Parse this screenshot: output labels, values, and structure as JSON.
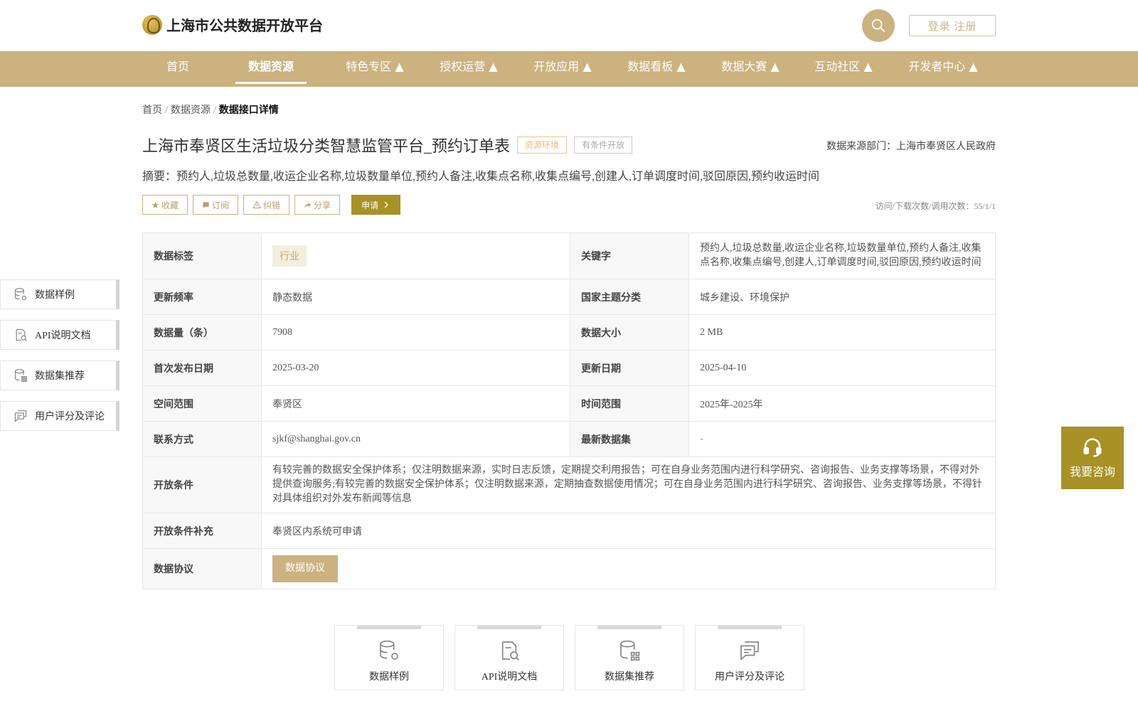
{
  "header": {
    "site_title": "上海市公共数据开放平台",
    "login_label": "登录 注册"
  },
  "nav": [
    {
      "label": "首页"
    },
    {
      "label": "数据资源"
    },
    {
      "label": "特色专区 ▲"
    },
    {
      "label": "授权运营 ▲"
    },
    {
      "label": "开放应用 ▲"
    },
    {
      "label": "数据看板 ▲"
    },
    {
      "label": "数据大赛 ▲"
    },
    {
      "label": "互动社区 ▲"
    },
    {
      "label": "开发者中心 ▲"
    }
  ],
  "breadcrumb": [
    "首页",
    "数据资源",
    "数据接口详情"
  ],
  "detail": {
    "title": "上海市奉贤区生活垃圾分类智慧监管平台_预约订单表",
    "tag_env": "资源环境",
    "tag_open": "有条件开放",
    "source_label": "数据来源部门：上海市奉贤区人民政府",
    "summary": "摘要：预约人,垃圾总数量,收运企业名称,垃圾数量单位,预约人备注,收集点名称,收集点编号,创建人,订单调度时间,驳回原因,预约收运时间",
    "visits": "访问/下载次数/调用次数：55/1/1"
  },
  "actions": {
    "favorite": "收藏",
    "subscribe": "订阅",
    "correct": "纠错",
    "share": "分享",
    "apply": "申请"
  },
  "table": {
    "tag_key": "数据标签",
    "tag_val": "行业",
    "keyword_key": "关键字",
    "keyword_val": "预约人,垃圾总数量,收运企业名称,垃圾数量单位,预约人备注,收集点名称,收集点编号,创建人,订单调度时间,驳回原因,预约收运时间",
    "freq_key": "更新频率",
    "freq_val": "静态数据",
    "theme_key": "国家主题分类",
    "theme_val": "城乡建设、环境保护",
    "count_key": "数据量（条）",
    "count_val": "7908",
    "size_key": "数据大小",
    "size_val": "2 MB",
    "first_key": "首次发布日期",
    "first_val": "2025-03-20",
    "update_key": "更新日期",
    "update_val": "2025-04-10",
    "space_key": "空间范围",
    "space_val": "奉贤区",
    "time_key": "时间范围",
    "time_val": "2025年-2025年",
    "contact_key": "联系方式",
    "contact_val": "sjkf@shanghai.gov.cn",
    "latest_key": "最新数据集",
    "latest_val": "-",
    "cond_key": "开放条件",
    "cond_val": "有较完善的数据安全保护体系；仅注明数据来源，实时日志反馈，定期提交利用报告；可在自身业务范围内进行科学研究、咨询报告、业务支撑等场景，不得对外提供查询服务;有较完善的数据安全保护体系；仅注明数据来源，定期抽查数据使用情况；可在自身业务范围内进行科学研究、咨询报告、业务支撑等场景，不得针对具体组织对外发布新闻等信息",
    "cond_extra_key": "开放条件补充",
    "cond_extra_val": "奉贤区内系统可申请",
    "protocol_key": "数据协议",
    "protocol_btn": "数据协议"
  },
  "side_nav": [
    "数据样例",
    "API说明文档",
    "数据集推荐",
    "用户评分及评论"
  ],
  "consult_label": "我要咨询",
  "bottom_cards": [
    "数据样例",
    "API说明文档",
    "数据集推荐",
    "用户评分及评论"
  ],
  "colors": {
    "gold": "#cbb27f",
    "olive": "#a89125"
  }
}
